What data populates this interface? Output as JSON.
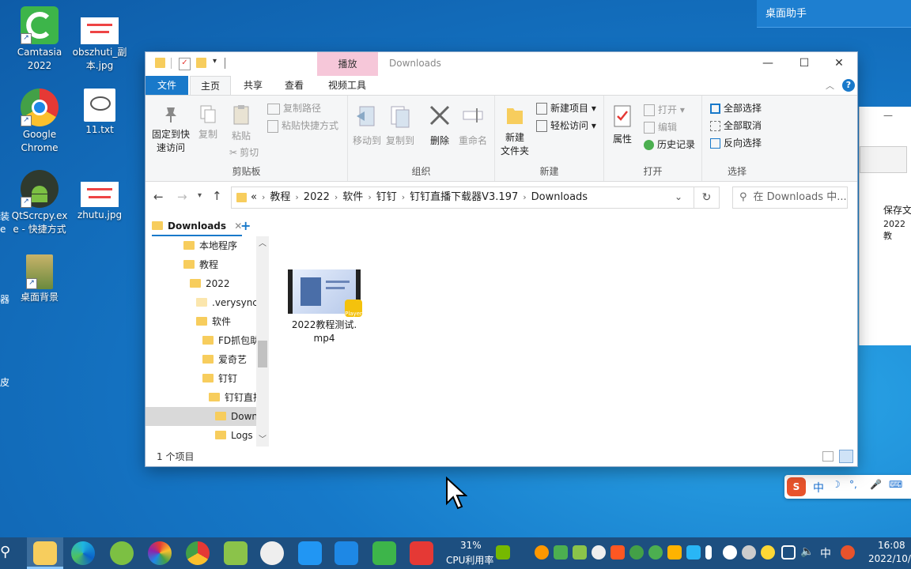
{
  "desktop": {
    "icons": [
      {
        "label": "Camtasia\n2022"
      },
      {
        "label": "obszhuti_副\n本.jpg"
      },
      {
        "label": "Google\nChrome"
      },
      {
        "label": "11.txt"
      },
      {
        "label": "QtScrcpy.ex\ne - 快捷方式"
      },
      {
        "label": "zhutu.jpg"
      },
      {
        "label": "桌面背景"
      }
    ],
    "edge_left_1": "装",
    "edge_left_2": "e",
    "edge_left_3": "器",
    "edge_left_4": "皮",
    "helper_title": "桌面助手",
    "bg_window_text_1": "保存文",
    "bg_window_text_2": "2022教",
    "ime_label": "中",
    "colors": {
      "desktop": "#1679c9",
      "taskbar": "#1d4f80",
      "file_tab": "#1979ca",
      "context_tab": "#f6c7d9"
    }
  },
  "explorer": {
    "context_tab": "播放",
    "title": "Downloads",
    "tabs": [
      "文件",
      "主页",
      "共享",
      "查看",
      "视频工具"
    ],
    "active_tab": "主页",
    "clipboard": {
      "pin_label": "固定到快\n速访问",
      "copy_label": "复制",
      "paste_label": "粘贴",
      "copy_path_label": "复制路径",
      "paste_shortcut_label": "粘贴快捷方式",
      "cut_label": "剪切",
      "group_label": "剪贴板"
    },
    "organize": {
      "move_to_label": "移动到",
      "copy_to_label": "复制到",
      "delete_label": "删除",
      "rename_label": "重命名",
      "group_label": "组织"
    },
    "new": {
      "new_folder_label": "新建\n文件夹",
      "new_item_label": "新建项目 ▾",
      "easy_access_label": "轻松访问 ▾",
      "group_label": "新建"
    },
    "open": {
      "properties_label": "属性",
      "open_label": "打开 ▾",
      "edit_label": "编辑",
      "history_label": "历史记录",
      "group_label": "打开"
    },
    "select": {
      "select_all_label": "全部选择",
      "select_none_label": "全部取消",
      "invert_label": "反向选择",
      "group_label": "选择"
    },
    "address": {
      "overflow": "«",
      "crumbs": [
        "教程",
        "2022",
        "软件",
        "钉钉",
        "钉钉直播下载器V3.197",
        "Downloads"
      ]
    },
    "search_placeholder": "在 Downloads 中...",
    "folder_tab": "Downloads",
    "nav_items": [
      "本地程序",
      "教程",
      "2022",
      ".verysync",
      "软件",
      "FD抓包助",
      "爱奇艺",
      "钉钉",
      "钉钉直播",
      "Downl",
      "Logs"
    ],
    "selected_nav": "Downl",
    "files": [
      {
        "name": "2022教程测试.\nmp4",
        "badge": "Player"
      }
    ],
    "status": "1 个项目"
  },
  "taskbar": {
    "cpu_percent": "31%",
    "cpu_label": "CPU利用率",
    "ime": "中",
    "time": "16:08",
    "date": "2022/10/"
  }
}
